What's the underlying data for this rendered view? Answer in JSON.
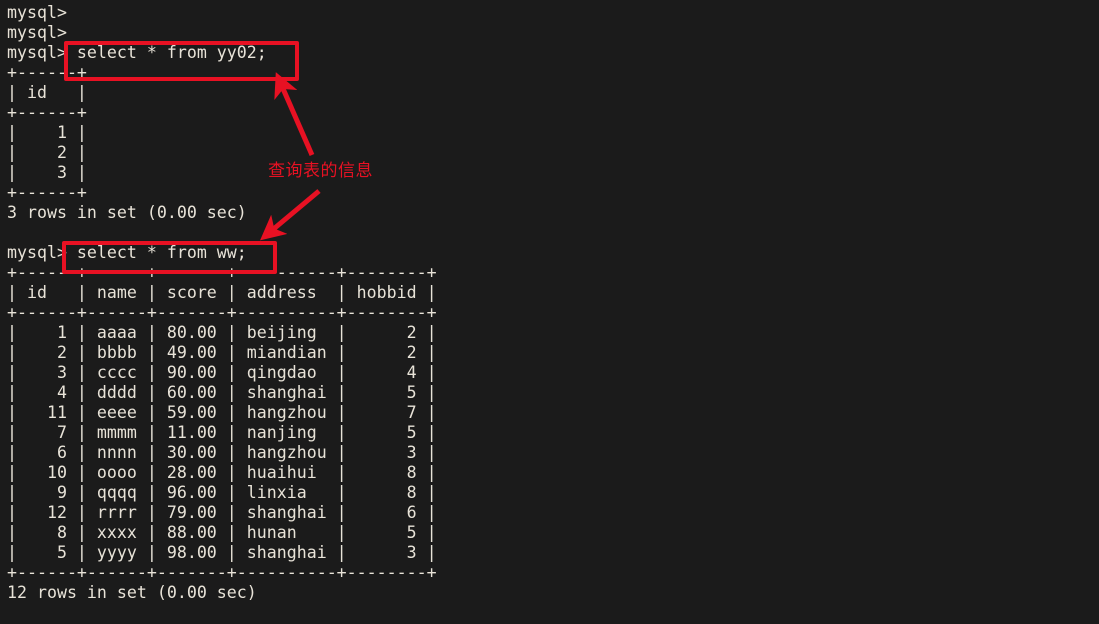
{
  "terminal": {
    "background_color": "#1b1b1b",
    "text_color": "#e8e3d8",
    "prompt": "mysql>",
    "lines": [
      "mysql> ",
      "mysql> ",
      "mysql> select * from yy02;",
      "+------+",
      "| id   |",
      "+------+",
      "|    1 |",
      "|    2 |",
      "|    3 |",
      "+------+",
      "3 rows in set (0.00 sec)",
      "",
      "mysql> select * from ww;",
      "+------+------+-------+----------+--------+",
      "| id   | name | score | address  | hobbid |",
      "+------+------+-------+----------+--------+",
      "|    1 | aaaa | 80.00 | beijing  |      2 |",
      "|    2 | bbbb | 49.00 | miandian |      2 |",
      "|    3 | cccc | 90.00 | qingdao  |      4 |",
      "|    4 | dddd | 60.00 | shanghai |      5 |",
      "|   11 | eeee | 59.00 | hangzhou |      7 |",
      "|    7 | mmmm | 11.00 | nanjing  |      5 |",
      "|    6 | nnnn | 30.00 | hangzhou |      3 |",
      "|   10 | oooo | 28.00 | huaihui  |      8 |",
      "|    9 | qqqq | 96.00 | linxia   |      8 |",
      "|   12 | rrrr | 79.00 | shanghai |      6 |",
      "|    8 | xxxx | 88.00 | hunan    |      5 |",
      "|    5 | yyyy | 98.00 | shanghai |      3 |",
      "+------+------+-------+----------+--------+",
      "12 rows in set (0.00 sec)"
    ]
  },
  "commands": {
    "first_query": "select * from yy02;",
    "second_query": "select * from ww;"
  },
  "results": {
    "first": {
      "columns": [
        "id"
      ],
      "rows": [
        [
          "1"
        ],
        [
          "2"
        ],
        [
          "3"
        ]
      ],
      "status": "3 rows in set (0.00 sec)",
      "row_count": 3,
      "elapsed": "0.00 sec"
    },
    "second": {
      "columns": [
        "id",
        "name",
        "score",
        "address",
        "hobbid"
      ],
      "rows": [
        [
          "1",
          "aaaa",
          "80.00",
          "beijing",
          "2"
        ],
        [
          "2",
          "bbbb",
          "49.00",
          "miandian",
          "2"
        ],
        [
          "3",
          "cccc",
          "90.00",
          "qingdao",
          "4"
        ],
        [
          "4",
          "dddd",
          "60.00",
          "shanghai",
          "5"
        ],
        [
          "11",
          "eeee",
          "59.00",
          "hangzhou",
          "7"
        ],
        [
          "7",
          "mmmm",
          "11.00",
          "nanjing",
          "5"
        ],
        [
          "6",
          "nnnn",
          "30.00",
          "hangzhou",
          "3"
        ],
        [
          "10",
          "oooo",
          "28.00",
          "huaihui",
          "8"
        ],
        [
          "9",
          "qqqq",
          "96.00",
          "linxia",
          "8"
        ],
        [
          "12",
          "rrrr",
          "79.00",
          "shanghai",
          "6"
        ],
        [
          "8",
          "xxxx",
          "88.00",
          "hunan",
          "5"
        ],
        [
          "5",
          "yyyy",
          "98.00",
          "shanghai",
          "3"
        ]
      ],
      "status": "12 rows in set (0.00 sec)",
      "row_count": 12,
      "elapsed": "0.00 sec"
    }
  },
  "annotations": {
    "color": "#e81123",
    "label": "查询表的信息",
    "highlight_1_target": "select * from yy02;",
    "highlight_2_target": "select * from ww;"
  }
}
